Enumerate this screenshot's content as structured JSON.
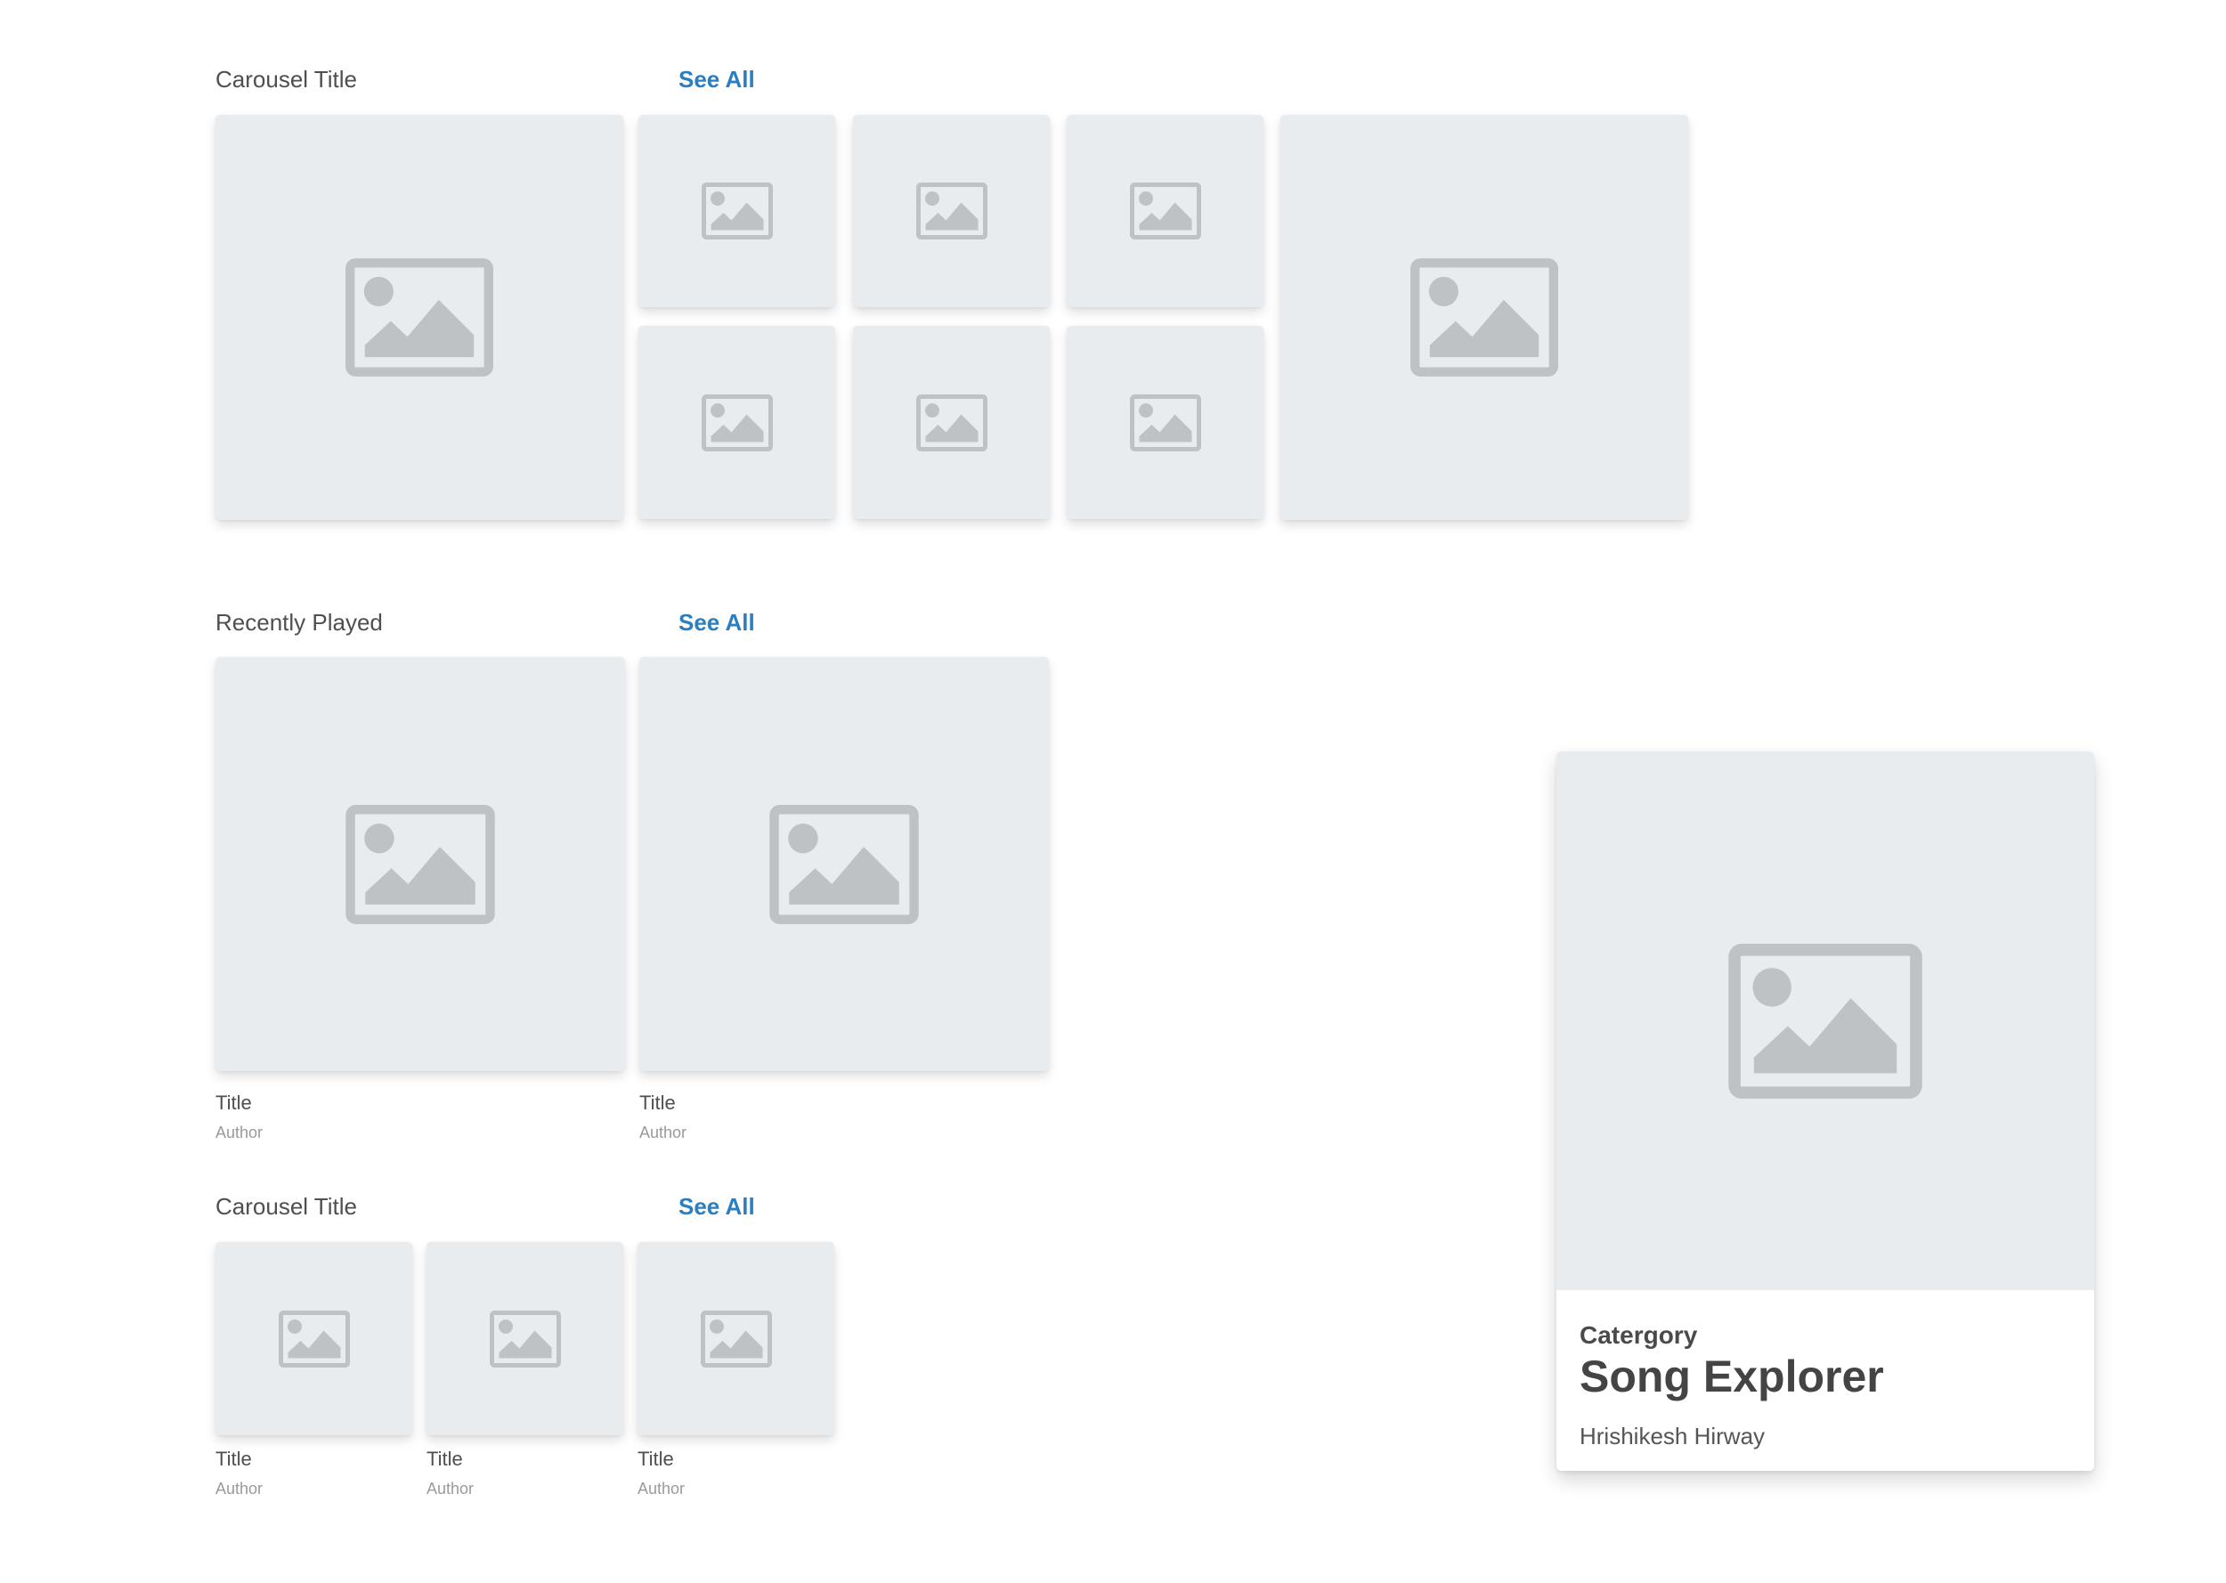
{
  "sections": [
    {
      "title": "Carousel Title",
      "see_all": "See All"
    },
    {
      "title": "Recently Played",
      "see_all": "See All"
    },
    {
      "title": "Carousel Title",
      "see_all": "See All"
    }
  ],
  "recently_played": [
    {
      "title": "Title",
      "author": "Author"
    },
    {
      "title": "Title",
      "author": "Author"
    }
  ],
  "carousel_small": [
    {
      "title": "Title",
      "author": "Author"
    },
    {
      "title": "Title",
      "author": "Author"
    },
    {
      "title": "Title",
      "author": "Author"
    }
  ],
  "feature": {
    "category": "Catergory",
    "title": "Song Explorer",
    "author": "Hrishikesh Hirway"
  },
  "icons": {
    "placeholder": "image-placeholder-icon"
  },
  "colors": {
    "accent": "#2b7fc0",
    "tile_background": "#e9ecef",
    "placeholder_icon": "#bfc2c5"
  }
}
